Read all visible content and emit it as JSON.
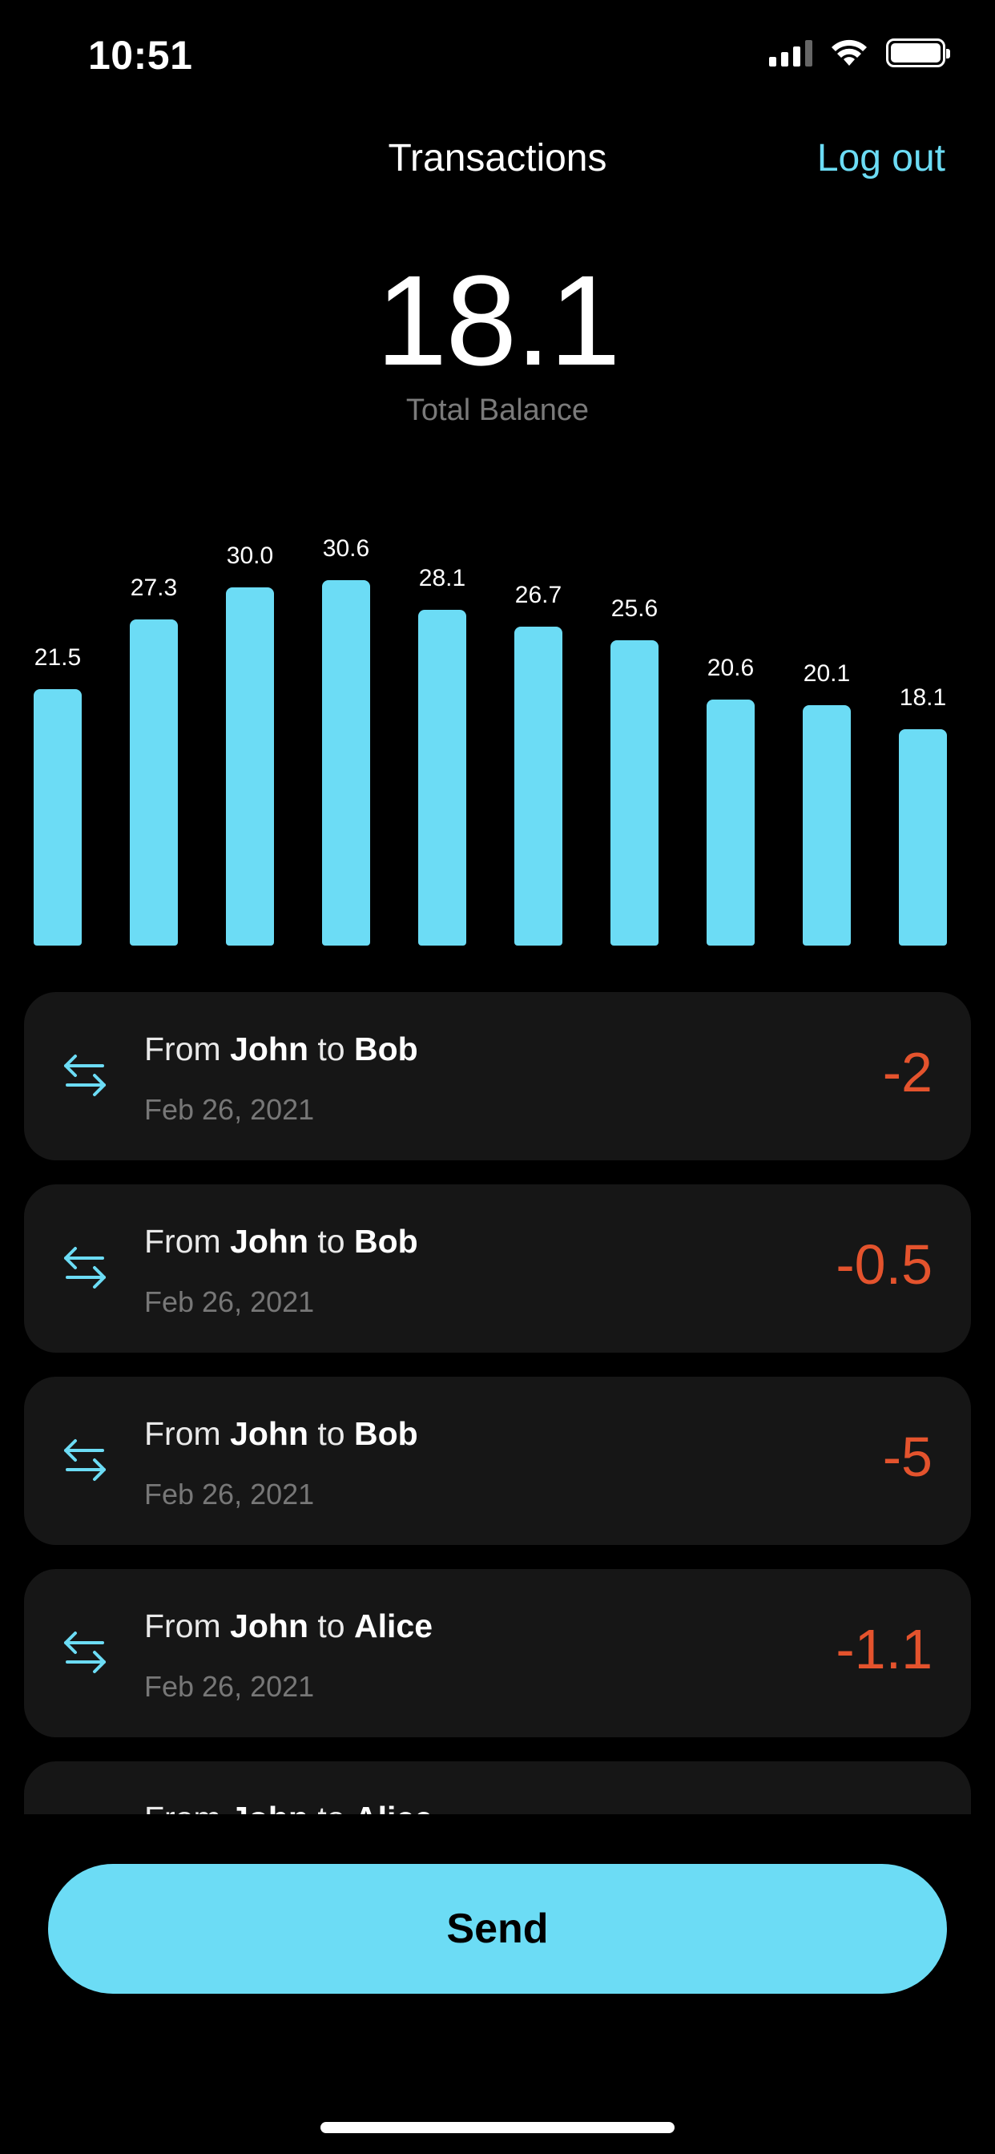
{
  "status_bar": {
    "time": "10:51"
  },
  "header": {
    "title": "Transactions",
    "logout_label": "Log out"
  },
  "balance": {
    "value": "18.1",
    "label": "Total Balance"
  },
  "chart_data": {
    "type": "bar",
    "values": [
      21.5,
      27.3,
      30.0,
      30.6,
      28.1,
      26.7,
      25.6,
      20.6,
      20.1,
      18.1
    ],
    "labels": [
      "21.5",
      "27.3",
      "30.0",
      "30.6",
      "28.1",
      "26.7",
      "25.6",
      "20.6",
      "20.1",
      "18.1"
    ],
    "ylim": [
      0,
      30.6
    ],
    "color": "#6cdcf5"
  },
  "transactions": [
    {
      "from_prefix": "From",
      "from": "John",
      "to_prefix": "to",
      "to": "Bob",
      "date": "Feb 26, 2021",
      "amount": "-2"
    },
    {
      "from_prefix": "From",
      "from": "John",
      "to_prefix": "to",
      "to": "Bob",
      "date": "Feb 26, 2021",
      "amount": "-0.5"
    },
    {
      "from_prefix": "From",
      "from": "John",
      "to_prefix": "to",
      "to": "Bob",
      "date": "Feb 26, 2021",
      "amount": "-5"
    },
    {
      "from_prefix": "From",
      "from": "John",
      "to_prefix": "to",
      "to": "Alice",
      "date": "Feb 26, 2021",
      "amount": "-1.1"
    },
    {
      "from_prefix": "From",
      "from": "John",
      "to_prefix": "to",
      "to": "Alice"
    }
  ],
  "send_label": "Send",
  "colors": {
    "accent": "#6cdcf5",
    "negative": "#e4532d",
    "card": "#161616"
  },
  "icons": {
    "transfer": "arrows-left-right-icon"
  }
}
